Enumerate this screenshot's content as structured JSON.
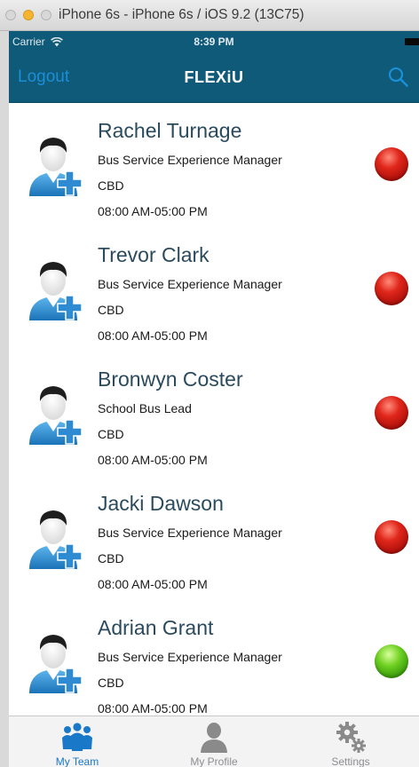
{
  "simulator": {
    "title": "iPhone 6s - iPhone 6s / iOS 9.2 (13C75)"
  },
  "status_bar": {
    "carrier": "Carrier",
    "time": "8:39 PM"
  },
  "nav": {
    "logout_label": "Logout",
    "title": "FLEXiU",
    "search_icon": "search-icon"
  },
  "members": [
    {
      "name": "Rachel Turnage",
      "role": "Bus Service Experience Manager",
      "location": "CBD",
      "hours": "08:00 AM-05:00 PM",
      "status": "red"
    },
    {
      "name": "Trevor Clark",
      "role": "Bus Service Experience Manager",
      "location": "CBD",
      "hours": "08:00 AM-05:00 PM",
      "status": "red"
    },
    {
      "name": "Bronwyn Coster",
      "role": "School Bus Lead",
      "location": "CBD",
      "hours": "08:00 AM-05:00 PM",
      "status": "red"
    },
    {
      "name": "Jacki Dawson",
      "role": "Bus Service Experience Manager",
      "location": "CBD",
      "hours": "08:00 AM-05:00 PM",
      "status": "red"
    },
    {
      "name": "Adrian Grant",
      "role": "Bus Service Experience Manager",
      "location": "CBD",
      "hours": "08:00 AM-05:00 PM",
      "status": "green"
    }
  ],
  "tabs": [
    {
      "label": "My Team",
      "icon": "team-icon",
      "active": true
    },
    {
      "label": "My Profile",
      "icon": "profile-icon",
      "active": false
    },
    {
      "label": "Settings",
      "icon": "gear-icon",
      "active": false
    }
  ],
  "colors": {
    "nav_background": "#0f5a78",
    "accent": "#1b8fd6",
    "status_red": "#d0201a",
    "status_green": "#5bbf18"
  }
}
